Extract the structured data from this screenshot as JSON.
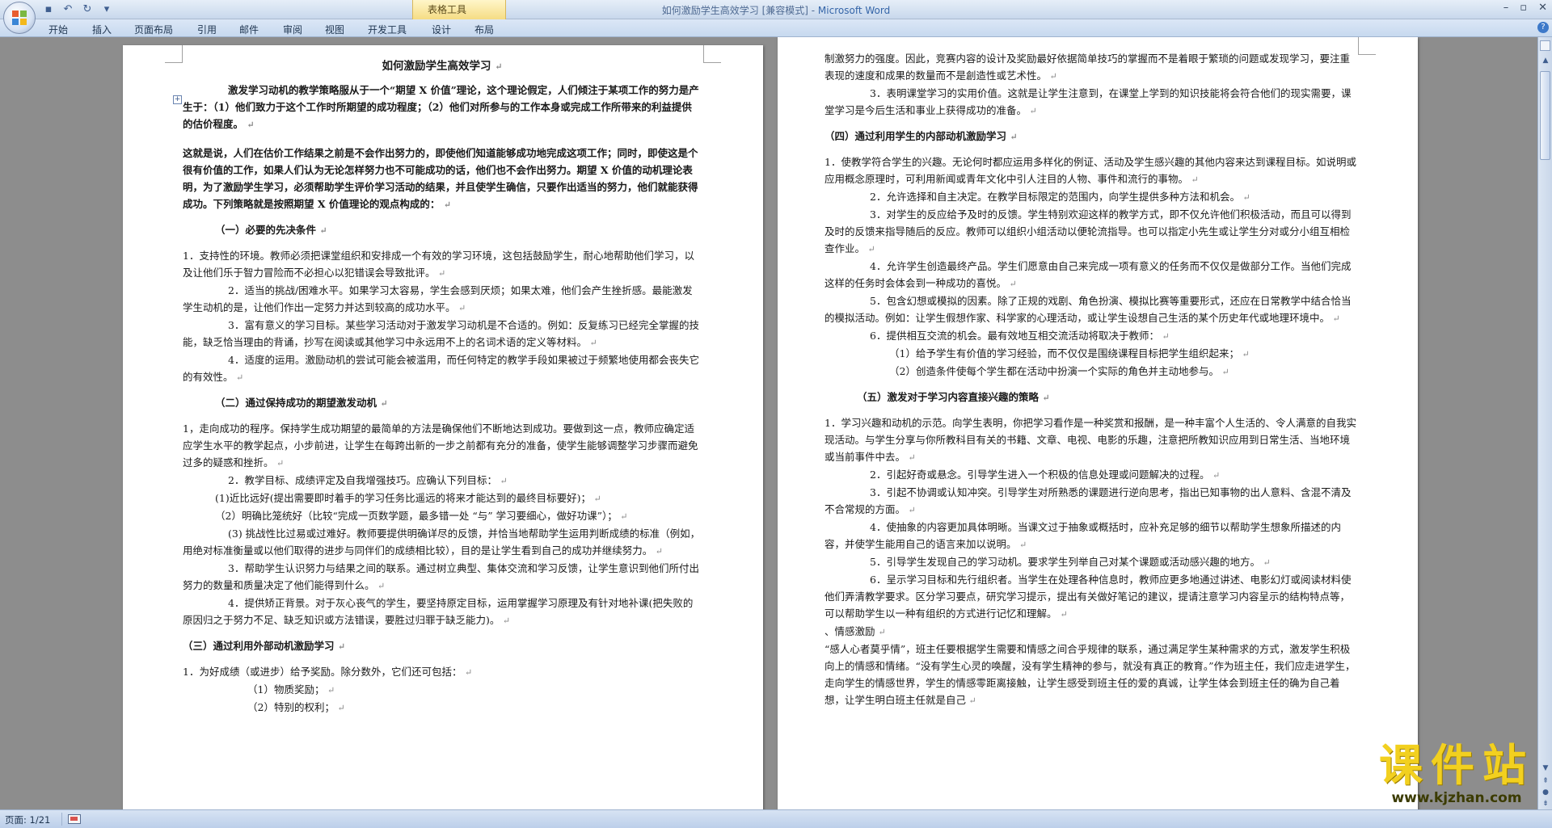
{
  "window": {
    "title": "如何激励学生高效学习 [兼容模式] - ",
    "app_name": "Microsoft Word",
    "context_tab_group": "表格工具"
  },
  "ribbon_tabs": [
    "开始",
    "插入",
    "页面布局",
    "引用",
    "邮件",
    "审阅",
    "视图",
    "开发工具",
    "设计",
    "布局"
  ],
  "icons": {
    "office_button": "office-logo-icon",
    "save": "save-icon",
    "undo": "undo-icon",
    "redo": "redo-icon",
    "qat_more": "chevron-down-icon",
    "help": "help-icon"
  },
  "colors": {
    "accent": "#3565a8",
    "context_tab": "#f5dc84",
    "watermark": "#f2d01f"
  },
  "page_left": [
    {
      "cls": "title",
      "text": "如何激励学生高效学习 "
    },
    {
      "cls": "bold ind1",
      "text": "激发学习动机的教学策略服从于一个“期望 X 价值”理论，这个理论假定，人们倾注于某项工作的努力是产生于：（1）他们致力于这个工作时所期望的成功程度；（2）他们对所参与的工作本身或完成工作所带来的利益提供的估价程度。 "
    },
    {
      "cls": "bold sp",
      "text": "这就是说，人们在估价工作结果之前是不会作出努力的，即使他们知道能够成功地完成这项工作；同时，即使这是个很有价值的工作，如果人们认为无论怎样努力也不可能成功的话，他们也不会作出努力。期望 X 价值的动机理论表明，为了激励学生学习，必须帮助学生评价学习活动的结果，并且使学生确信，只要作出适当的努力，他们就能获得成功。下列策略就是按照期望 X 价值理论的观点构成的： "
    },
    {
      "cls": "heading ind2",
      "text": "（一）必要的先决条件 "
    },
    {
      "cls": "",
      "text": "1．支持性的环境。教师必须把课堂组织和安排成一个有效的学习环境，这包括鼓励学生，耐心地帮助他们学习，以及让他们乐于智力冒险而不必担心以犯错误会导致批评。"
    },
    {
      "cls": "ind1",
      "text": "2．适当的挑战/困难水平。如果学习太容易，学生会感到厌烦；如果太难，他们会产生挫折感。最能激发学生动机的是，让他们作出一定努力并达到较高的成功水平。"
    },
    {
      "cls": "ind1",
      "text": "3．富有意义的学习目标。某些学习活动对于激发学习动机是不合适的。例如：反复练习已经完全掌握的技能，缺乏恰当理由的背诵，抄写在阅读或其他学习中永远用不上的名词术语的定义等材料。"
    },
    {
      "cls": "ind1",
      "text": "4．适度的运用。激励动机的尝试可能会被滥用，而任何特定的教学手段如果被过于频繁地使用都会丧失它的有效性。"
    },
    {
      "cls": "heading ind2",
      "text": "（二）通过保持成功的期望激发动机 "
    },
    {
      "cls": "",
      "text": "1，走向成功的程序。保持学生成功期望的最简单的方法是确保他们不断地达到成功。要做到这一点，教师应确定适应学生水平的教学起点，小步前进，让学生在每跨出新的一步之前都有充分的准备，使学生能够调整学习步骤而避免过多的疑惑和挫折。"
    },
    {
      "cls": "ind1",
      "text": "2．教学目标、成绩评定及自我增强技巧。应确认下列目标："
    },
    {
      "cls": "ind2",
      "text": "(1)近比远好(提出需要即时着手的学习任务比遥远的将来才能达到的最终目标要好)；"
    },
    {
      "cls": "ind2",
      "text": "（2）明确比笼统好（比较“完成一页数学题，最多错一处 “与” 学习要细心，做好功课”）；"
    },
    {
      "cls": "ind1",
      "text": "(3) 挑战性比过易或过难好。教师要提供明确详尽的反馈，并恰当地帮助学生运用判断成绩的标准（例如，用绝对标准衡量或以他们取得的进步与同伴们的成绩相比较），目的是让学生看到自己的成功并继续努力。"
    },
    {
      "cls": "ind1",
      "text": "3．帮助学生认识努力与结果之间的联系。通过树立典型、集体交流和学习反馈，让学生意识到他们所付出努力的数量和质量决定了他们能得到什么。"
    },
    {
      "cls": "ind1",
      "text": "4．提供矫正背景。对于灰心丧气的学生，要坚持原定目标，运用掌握学习原理及有针对地补课(把失败的原因归之于努力不足、缺乏知识或方法错误，要胜过归罪于缺乏能力)。"
    },
    {
      "cls": "heading",
      "text": "（三）通过利用外部动机激励学习 "
    },
    {
      "cls": "",
      "text": "1．为好成绩（或进步）给予奖励。除分数外，它们还可包括："
    },
    {
      "cls": "ind3",
      "text": "（1）物质奖励；"
    },
    {
      "cls": "ind3",
      "text": "（2）特别的权利；"
    }
  ],
  "page_right": [
    {
      "cls": "",
      "text": "制激努力的强度。因此，竞赛内容的设计及奖励最好依据简单技巧的掌握而不是着眼于繁琐的问题或发现学习，要注重表现的速度和成果的数量而不是創造性或艺术性。"
    },
    {
      "cls": "ind1",
      "text": "3．表明课堂学习的实用价值。这就是让学生注意到，在课堂上学到的知识技能将会符合他们的现实需要，课堂学习是今后生活和事业上获得成功的准备。"
    },
    {
      "cls": "heading",
      "text": "（四）通过利用学生的内部动机激励学习 "
    },
    {
      "cls": "",
      "text": "1．使教学符合学生的兴趣。无论何时都应运用多样化的例证、活动及学生感兴趣的其他内容来达到课程目标。如说明或应用概念原理时，可利用新闻或青年文化中引人注目的人物、事件和流行的事物。"
    },
    {
      "cls": "ind1",
      "text": "2．允许选择和自主决定。在教学目标限定的范围内，向学生提供多种方法和机会。"
    },
    {
      "cls": "ind1",
      "text": "3．对学生的反应给予及时的反馈。学生特别欢迎这样的教学方式，即不仅允许他们积极活动，而且可以得到及时的反馈来指导随后的反应。教师可以组织小组活动以便轮流指导。也可以指定小先生或让学生分对或分小组互相检查作业。"
    },
    {
      "cls": "ind1",
      "text": "4．允许学生创造最终产品。学生们愿意由自己来完成一项有意义的任务而不仅仅是做部分工作。当他们完成这样的任务时会体会到一种成功的喜悦。"
    },
    {
      "cls": "ind1",
      "text": "5．包含幻想或模拟的因素。除了正规的戏剧、角色扮演、模拟比赛等重要形式，还应在日常教学中结合恰当的模拟活动。例如：让学生假想作家、科学家的心理活动，或让学生设想自己生活的某个历史年代或地理环境中。"
    },
    {
      "cls": "ind1",
      "text": "6．提供相互交流的机会。最有效地互相交流活动将取决于教师："
    },
    {
      "cls": "ind3",
      "text": "（1）给予学生有价值的学习经验，而不仅仅是围绕课程目标把学生组织起来；"
    },
    {
      "cls": "ind3",
      "text": "（2）创造条件使每个学生都在活动中扮演一个实际的角色并主动地参与。"
    },
    {
      "cls": "heading ind2",
      "text": "（五）激发对于学习内容直接兴趣的策略 "
    },
    {
      "cls": "",
      "text": "1．学习兴趣和动机的示范。向学生表明，你把学习看作是一种奖赏和报酬，是一种丰富个人生活的、令人满意的自我实现活动。与学生分享与你所教科目有关的书籍、文章、电视、电影的乐趣，注意把所教知识应用到日常生活、当地环境或当前事件中去。"
    },
    {
      "cls": "ind1",
      "text": "2．引起好奇或悬念。引导学生进入一个积极的信息处理或问题解决的过程。"
    },
    {
      "cls": "ind1",
      "text": "3．引起不协调或认知冲突。引导学生对所熟悉的课题进行逆向思考，指出已知事物的出人意料、含混不清及不合常规的方面。"
    },
    {
      "cls": "ind1",
      "text": "4．使抽象的内容更加具体明晰。当课文过于抽象或概括时，应补充足够的细节以帮助学生想象所描述的内容，并使学生能用自己的语言来加以说明。"
    },
    {
      "cls": "ind1",
      "text": "5．引导学生发现自己的学习动机。要求学生列举自己对某个课题或活动感兴趣的地方。"
    },
    {
      "cls": "ind1",
      "text": "6．呈示学习目标和先行组织者。当学生在处理各种信息时，教师应更多地通过讲述、电影幻灯或阅读材料使他们弄清教学要求。区分学习要点，研究学习提示，提出有关做好笔记的建议，提请注意学习内容呈示的结构特点等，可以帮助学生以一种有组织的方式进行记忆和理解。 "
    },
    {
      "cls": "",
      "text": "、情感激励 "
    },
    {
      "cls": "",
      "text": "“感人心者莫乎情”，班主任要根据学生需要和情感之间合乎规律的联系，通过满足学生某种需求的方式，激发学生积极向上的情感和情绪。“没有学生心灵的唤醒，没有学生精神的参与，就没有真正的教育。”作为班主任，我们应走进学生，走向学生的情感世界，学生的情感零距离接触，让学生感受到班主任的爱的真诚，让学生体会到班主任的确为自己着想，让学生明白班主任就是自己"
    }
  ],
  "status": {
    "page_info": "页面: 1/21"
  },
  "watermark": {
    "text": "课件站",
    "url": "www.kjzhan.com"
  }
}
